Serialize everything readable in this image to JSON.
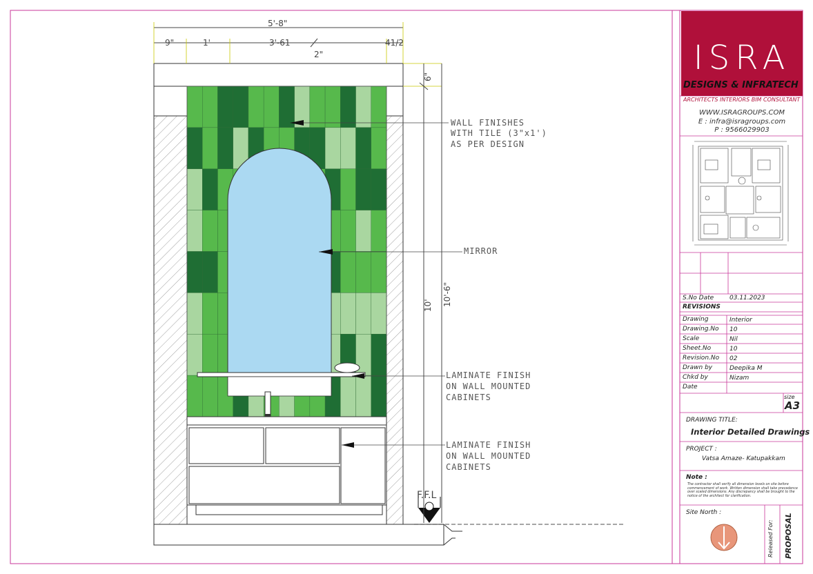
{
  "dimensions": {
    "overall_width": "5'-8\"",
    "seg_1": "9\"",
    "seg_2": "1'",
    "seg_3": "3'-61",
    "seg_4": "41/2",
    "seg_3_sub": "2\"",
    "top_height": "6\"",
    "height_10": "10'",
    "height_10_6": "10'-6\"",
    "ffl": "F.F.L"
  },
  "annotations": {
    "wall_finish": [
      "WALL FINISHES",
      "WITH TILE (3\"x1')",
      "AS PER DESIGN"
    ],
    "mirror": "MIRROR",
    "laminate_1": [
      "LAMINATE FINISH",
      "ON WALL MOUNTED",
      "CABINETS"
    ],
    "laminate_2": [
      "LAMINATE FINISH",
      "ON WALL MOUNTED",
      "CABINETS"
    ]
  },
  "colors": {
    "tile_dark": "#1f6e34",
    "tile_mid": "#57b94c",
    "tile_light": "#a9d6a0",
    "mirror": "#abd9f2",
    "border": "#c9379a",
    "brand": "#b0103a"
  },
  "title_block": {
    "logo": "ISRA",
    "company": "DESIGNS & INFRATECH",
    "tagline": "ARCHITECTS INTERIORS BIM CONSULTANT",
    "website": "WWW.ISRAGROUPS.COM",
    "email": "E : infra@isragroups.com",
    "phone": "P : 9566029903",
    "sno_date_label": "S.No Date",
    "sno_date_value": "03.11.2023",
    "revisions_label": "REVISIONS",
    "fields": [
      {
        "label": "Drawing",
        "value": "Interior"
      },
      {
        "label": "Drawing.No",
        "value": "10"
      },
      {
        "label": "Scale",
        "value": "Nil"
      },
      {
        "label": "Sheet.No",
        "value": "10"
      },
      {
        "label": "Revision.No",
        "value": "02"
      },
      {
        "label": "Drawn by",
        "value": "Deepika M"
      },
      {
        "label": "Chkd by",
        "value": "Nizam"
      },
      {
        "label": "Date",
        "value": ""
      }
    ],
    "size_label": "size",
    "size_value": "A3",
    "drawing_title_label": "DRAWING TITLE:",
    "drawing_title": "Interior Detailed Drawings",
    "project_label": "PROJECT :",
    "project": "Vatsa Amaze- Katupakkam",
    "note_label": "Note :",
    "note_text": "The contractor shall verify all dimension levels on site before commencement of work. Written dimension shall take precedence over scaled dimensions. Any discrepancy shall be brought to the notice of the architect for clarification.",
    "site_north_label": "Site North :",
    "released_for_label": "Released For:",
    "released_for": "PROPOSAL"
  }
}
